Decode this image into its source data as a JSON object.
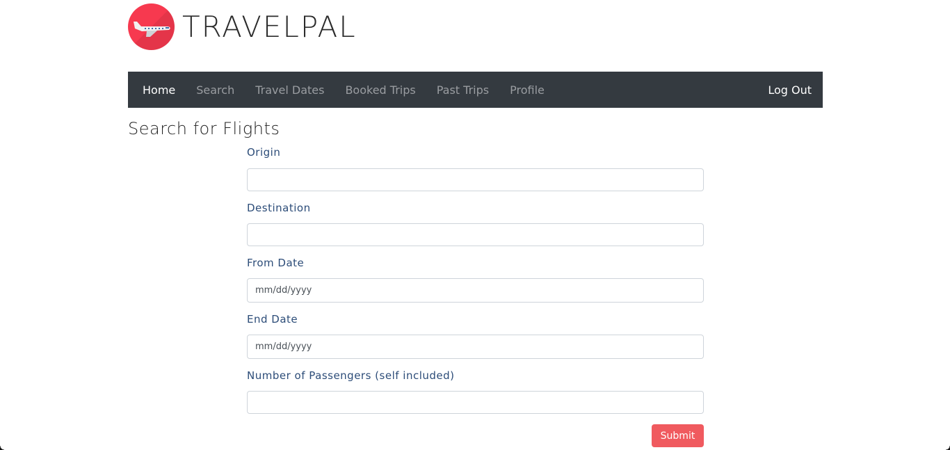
{
  "brand": {
    "name": "TRAVELPAL",
    "logo_icon": "airplane-icon",
    "logo_color": "#f7394f"
  },
  "navbar": {
    "items": [
      {
        "label": "Home",
        "active": true
      },
      {
        "label": "Search",
        "active": false
      },
      {
        "label": "Travel Dates",
        "active": false
      },
      {
        "label": "Booked Trips",
        "active": false
      },
      {
        "label": "Past Trips",
        "active": false
      },
      {
        "label": "Profile",
        "active": false
      }
    ],
    "logout_label": "Log Out",
    "background": "#343a40"
  },
  "page": {
    "title": "Search for Flights"
  },
  "form": {
    "origin": {
      "label": "Origin",
      "value": "",
      "placeholder": ""
    },
    "destination": {
      "label": "Destination",
      "value": "",
      "placeholder": ""
    },
    "from_date": {
      "label": "From Date",
      "value": "",
      "placeholder": "mm/dd/yyyy"
    },
    "end_date": {
      "label": "End Date",
      "value": "",
      "placeholder": "mm/dd/yyyy"
    },
    "passengers": {
      "label": "Number of Passengers (self included)",
      "value": "",
      "placeholder": ""
    },
    "submit_label": "Submit",
    "submit_color": "#f05a5f"
  }
}
